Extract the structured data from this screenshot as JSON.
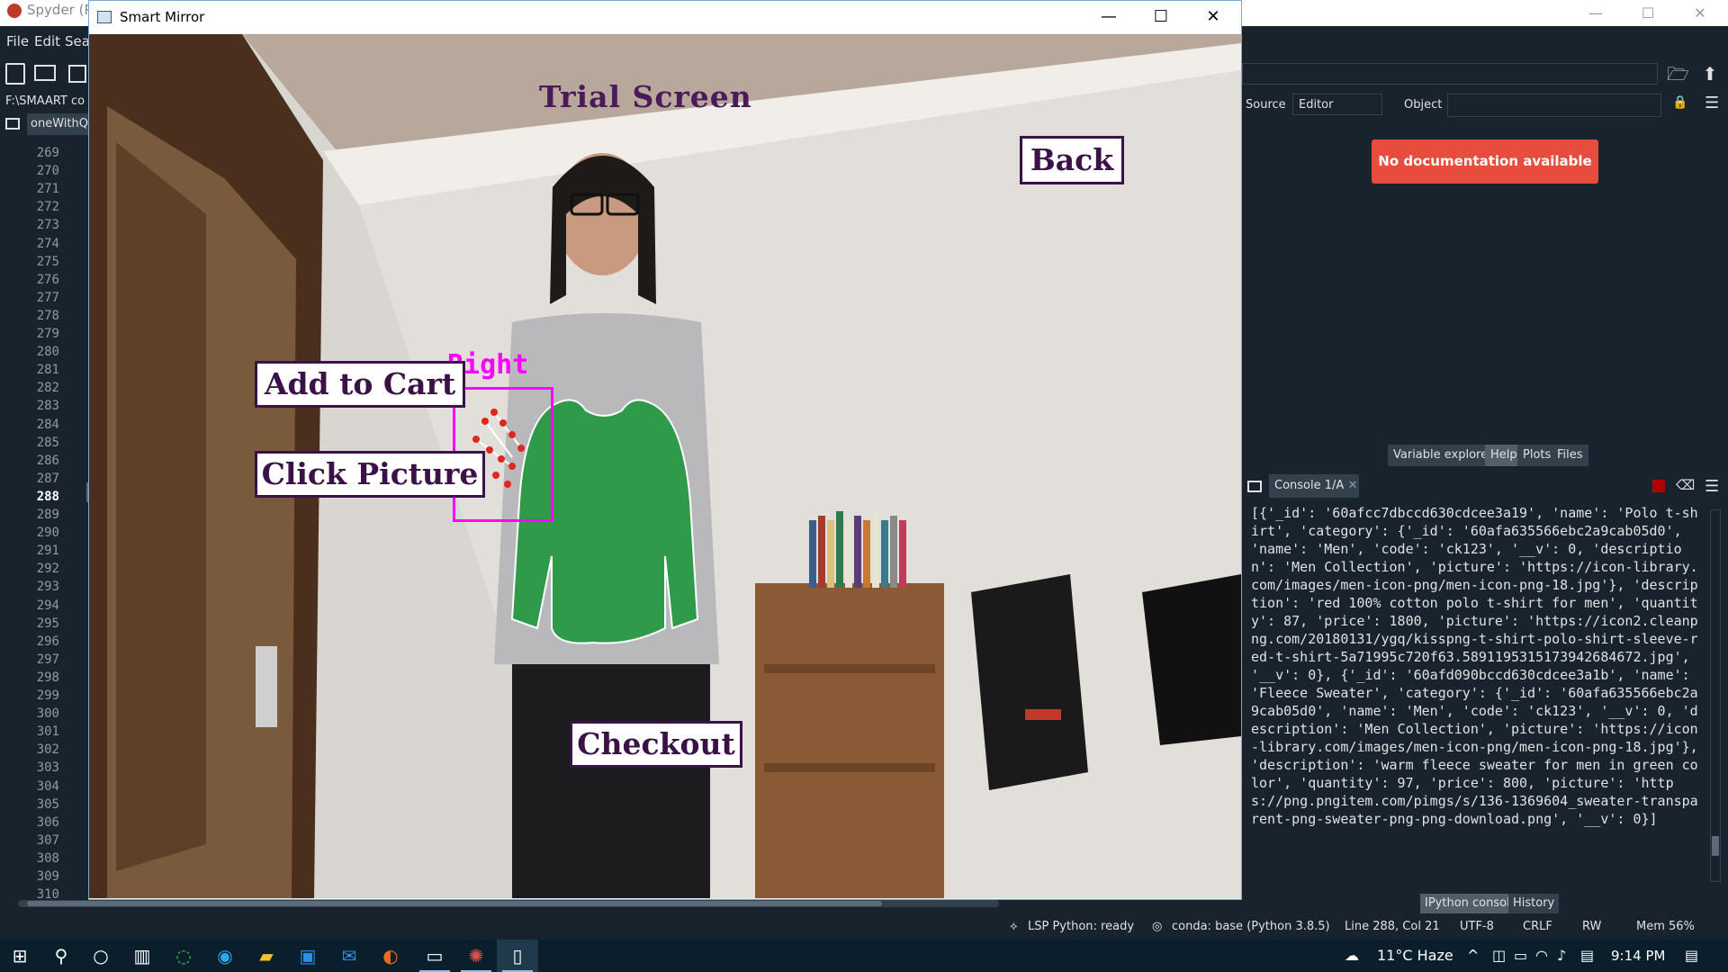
{
  "spyder": {
    "title": "Spyder (P",
    "menu": [
      "File",
      "Edit",
      "Sea"
    ],
    "path": "F:\\SMAART co",
    "editor_tab": "oneWithQR",
    "line_numbers": [
      "269",
      "270",
      "271",
      "272",
      "273",
      "274",
      "275",
      "276",
      "277",
      "278",
      "279",
      "280",
      "281",
      "282",
      "283",
      "284",
      "285",
      "286",
      "287",
      "288",
      "289",
      "290",
      "291",
      "292",
      "293",
      "294",
      "295",
      "296",
      "297",
      "298",
      "299",
      "300",
      "301",
      "302",
      "303",
      "304",
      "305",
      "306",
      "307",
      "308",
      "309",
      "310"
    ],
    "current_line": "288",
    "help": {
      "source_label": "Source",
      "source_value": "Editor",
      "object_label": "Object",
      "object_value": "",
      "no_doc": "No documentation available"
    },
    "pane_tabs": [
      "Variable explorer",
      "Help",
      "Plots",
      "Files"
    ],
    "pane_selected": "Help",
    "console_tab": "Console 1/A",
    "console_output": "[{'_id': '60afcc7dbccd630cdcee3a19', 'name': 'Polo t-shirt', 'category': {'_id': '60afa635566ebc2a9cab05d0', 'name': 'Men', 'code': 'ck123', '__v': 0, 'description': 'Men Collection', 'picture': 'https://icon-library.com/images/men-icon-png/men-icon-png-18.jpg'}, 'description': 'red 100% cotton polo t-shirt for men', 'quantity': 87, 'price': 1800, 'picture': 'https://icon2.cleanpng.com/20180131/ygq/kisspng-t-shirt-polo-shirt-sleeve-red-t-shirt-5a71995c720f63.5891195315173942684672.jpg', '__v': 0}, {'_id': '60afd090bccd630cdcee3a1b', 'name': 'Fleece Sweater', 'category': {'_id': '60afa635566ebc2a9cab05d0', 'name': 'Men', 'code': 'ck123', '__v': 0, 'description': 'Men Collection', 'picture': 'https://icon-library.com/images/men-icon-png/men-icon-png-18.jpg'}, 'description': 'warm fleece sweater for men in green color', 'quantity': 97, 'price': 800, 'picture': 'https://png.pngitem.com/pimgs/s/136-1369604_sweater-transparent-png-sweater-png-png-download.png', '__v': 0}]",
    "bottom_tabs": [
      "IPython console",
      "History"
    ],
    "status": {
      "lsp": "LSP Python: ready",
      "conda": "conda: base (Python 3.8.5)",
      "position": "Line 288, Col 21",
      "encoding": "UTF-8",
      "eol": "CRLF",
      "rw": "RW",
      "mem": "Mem 56%"
    }
  },
  "smart_mirror": {
    "window_title": "Smart Mirror",
    "screen_title": "Trial Screen",
    "back_label": "Back",
    "add_to_cart_label": "Add to Cart",
    "click_picture_label": "Click Picture",
    "checkout_label": "Checkout",
    "hand_label": "Right"
  },
  "taskbar": {
    "weather": "11°C  Haze",
    "time": "9:14 PM"
  }
}
